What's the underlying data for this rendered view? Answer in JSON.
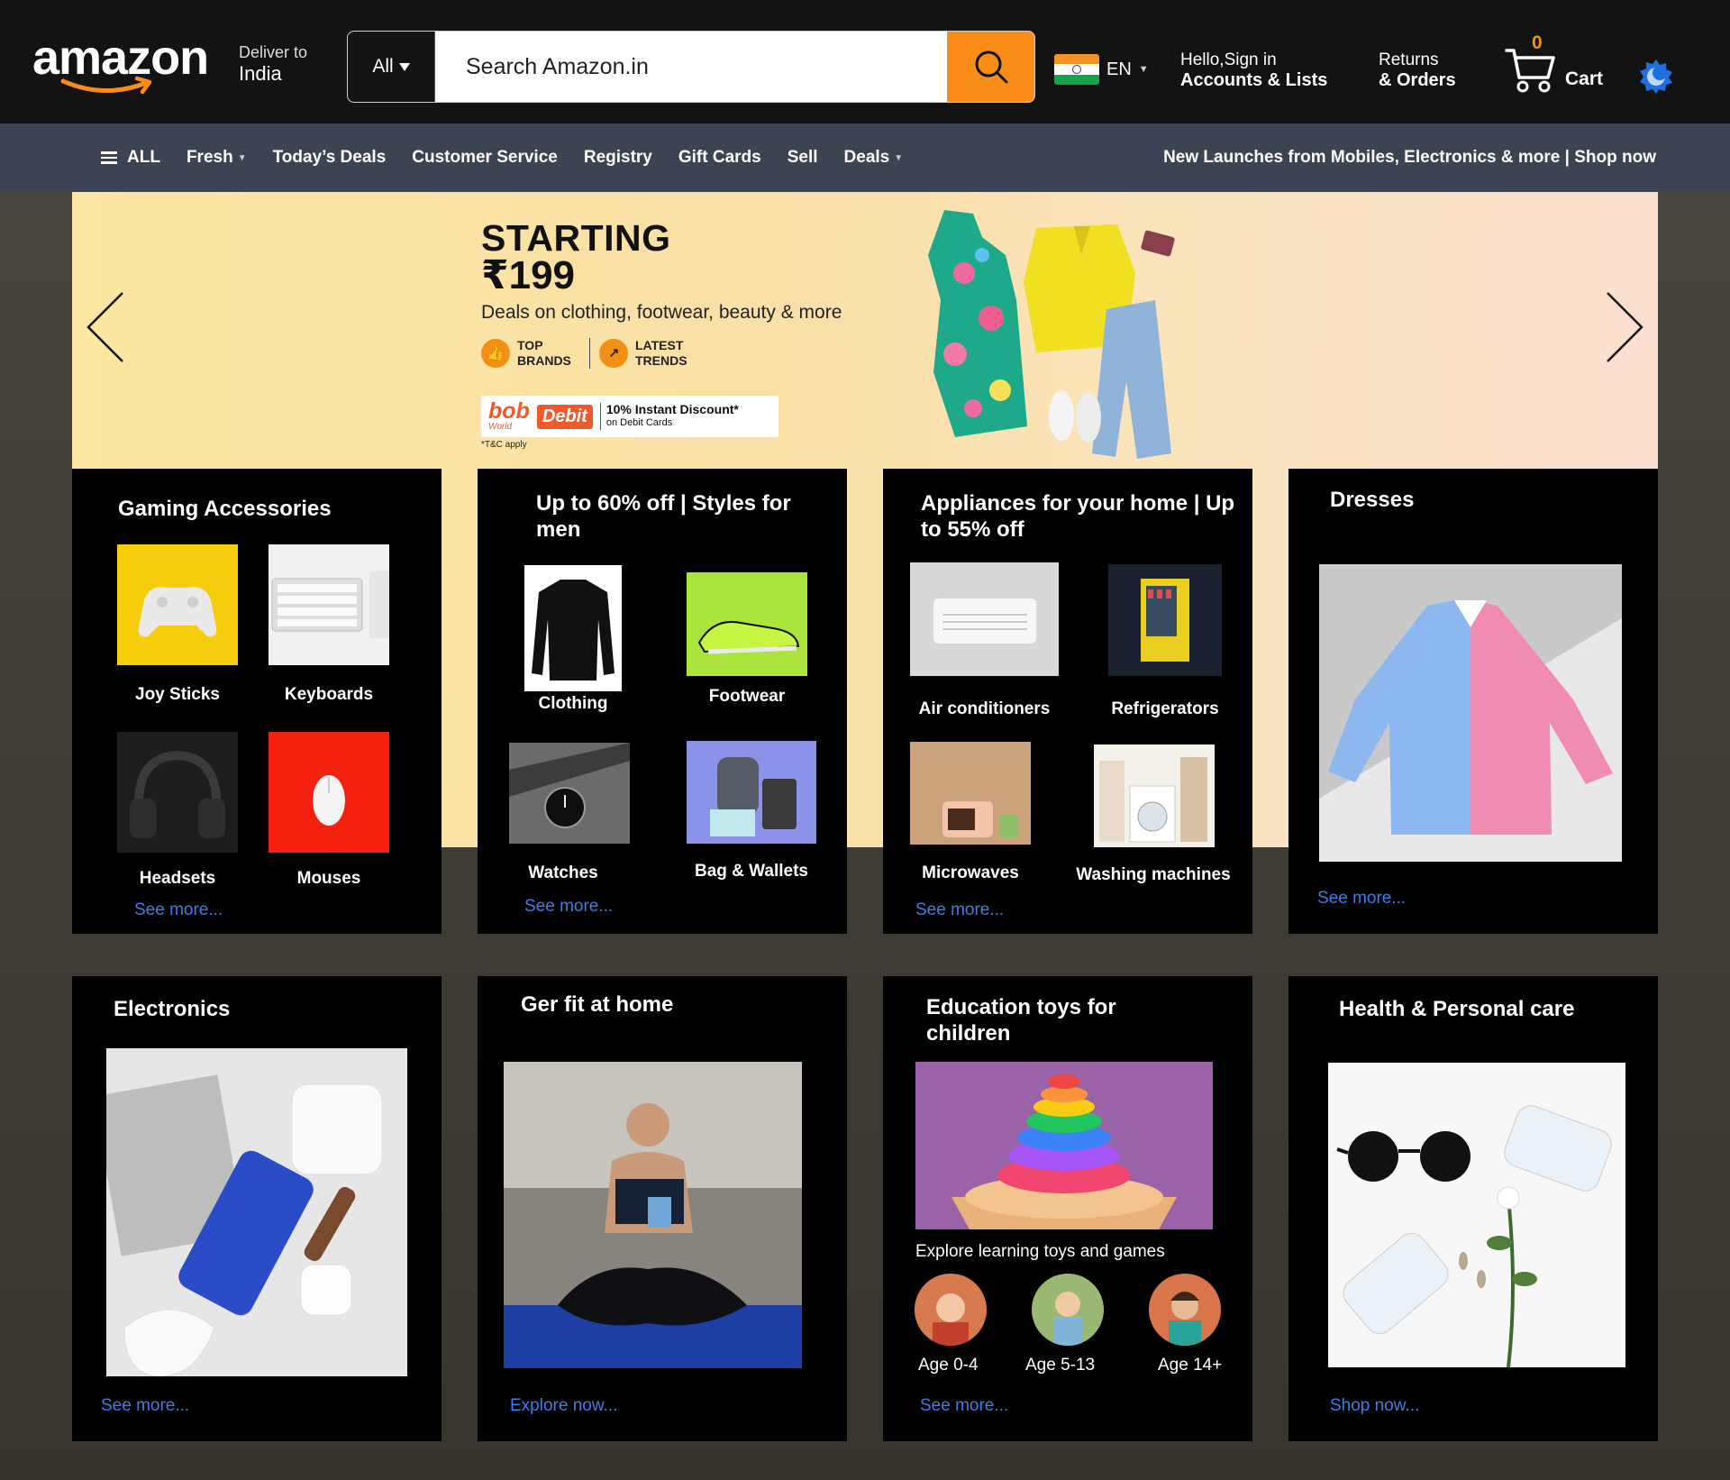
{
  "header": {
    "logo": "amazon",
    "deliver_line1": "Deliver to",
    "deliver_line2": "India",
    "search_category": "All",
    "search_placeholder": "Search Amazon.in",
    "language": "EN",
    "account_line1": "Hello,Sign in",
    "account_line2": "Accounts & Lists",
    "returns_line1": "Returns",
    "returns_line2": "& Orders",
    "cart_count": "0",
    "cart_label": "Cart"
  },
  "nav": {
    "items": [
      {
        "label": "ALL"
      },
      {
        "label": "Fresh"
      },
      {
        "label": "Today’s Deals"
      },
      {
        "label": "Customer Service"
      },
      {
        "label": "Registry"
      },
      {
        "label": "Gift Cards"
      },
      {
        "label": "Sell"
      },
      {
        "label": "Deals"
      }
    ],
    "promo": "New Launches from Mobiles, Electronics & more | Shop now"
  },
  "hero": {
    "title": "STARTING",
    "price": "₹199",
    "subtitle": "Deals on clothing, footwear, beauty & more",
    "badge1": "TOP BRANDS",
    "badge2": "LATEST TRENDS",
    "offer_brand": "bob",
    "offer_brand_sub": "World",
    "offer_card": "Debit",
    "offer_line1": "10% Instant Discount*",
    "offer_line2": "on Debit Cards",
    "terms": "*T&C apply"
  },
  "cards": {
    "gaming": {
      "title": "Gaming  Accessories",
      "items": [
        "Joy Sticks",
        "Keyboards",
        "Headsets",
        "Mouses"
      ],
      "link": "See more..."
    },
    "men": {
      "title": "Up to 60% off | Styles for men",
      "items": [
        "Clothing",
        "Footwear",
        "Watches",
        "Bag & Wallets"
      ],
      "link": "See more..."
    },
    "appliances": {
      "title": "Appliances for your home | Up to 55% off",
      "items": [
        "Air conditioners",
        "Refrigerators",
        "Microwaves",
        "Washing machines"
      ],
      "link": "See more..."
    },
    "dresses": {
      "title": "Dresses",
      "link": "See more..."
    },
    "electronics": {
      "title": "Electronics",
      "link": "See more..."
    },
    "fit": {
      "title": "Ger fit at home",
      "link": "Explore now..."
    },
    "toys": {
      "title": "Education toys for children",
      "subtitle": "Explore learning toys and games",
      "ages": [
        "Age 0-4",
        "Age 5-13",
        "Age 14+"
      ],
      "link": "See more..."
    },
    "health": {
      "title": "Health & Personal care",
      "link": "Shop now..."
    }
  },
  "colors": {
    "header_bg": "#131313",
    "nav_bg": "#3c4453",
    "accent": "#fa8d17",
    "link": "#3d7ee5"
  },
  "icons": {
    "search": "search-icon",
    "cart": "cart-icon",
    "menu": "hamburger-icon",
    "theme": "moon-icon",
    "prev": "chevron-left-icon",
    "next": "chevron-right-icon"
  }
}
